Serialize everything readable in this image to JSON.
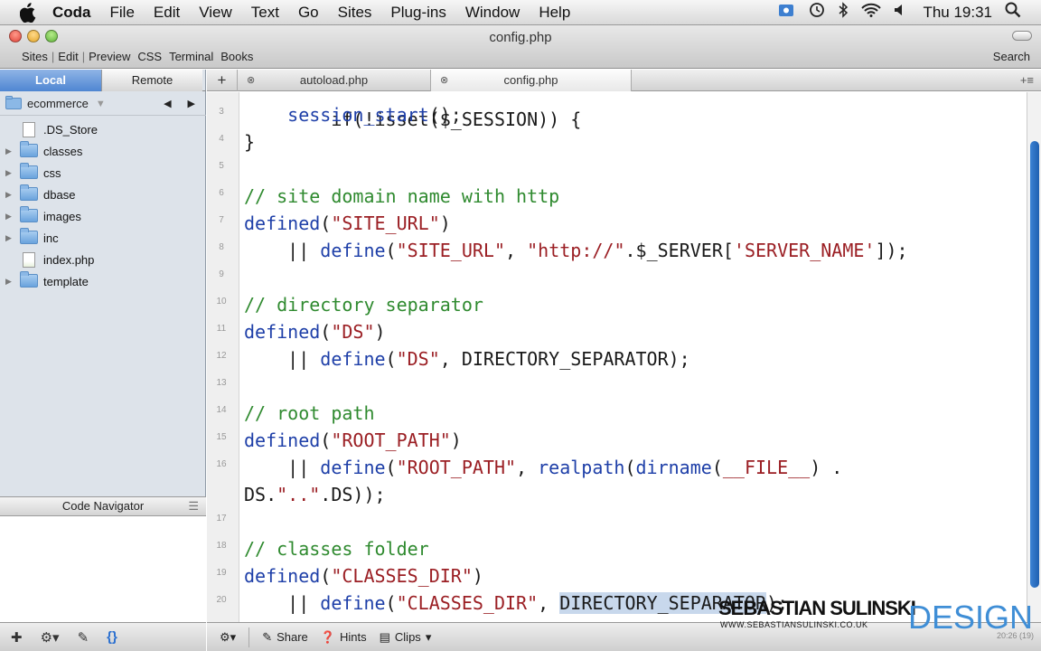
{
  "menubar": {
    "app": "Coda",
    "items": [
      "File",
      "Edit",
      "View",
      "Text",
      "Go",
      "Sites",
      "Plug-ins",
      "Window",
      "Help"
    ],
    "clock": "Thu 19:31"
  },
  "window": {
    "title": "config.php",
    "toolbar_tabs": [
      "Sites",
      "Edit",
      "Preview",
      "CSS",
      "Terminal",
      "Books"
    ],
    "search_label": "Search"
  },
  "sidebar": {
    "local_label": "Local",
    "remote_label": "Remote",
    "site_name": "ecommerce",
    "tree": [
      {
        "label": ".DS_Store",
        "type": "file"
      },
      {
        "label": "classes",
        "type": "folder"
      },
      {
        "label": "css",
        "type": "folder"
      },
      {
        "label": "dbase",
        "type": "folder"
      },
      {
        "label": "images",
        "type": "folder"
      },
      {
        "label": "inc",
        "type": "folder"
      },
      {
        "label": "index.php",
        "type": "php"
      },
      {
        "label": "template",
        "type": "folder"
      }
    ],
    "code_navigator_label": "Code Navigator"
  },
  "tabs": [
    {
      "label": "autoload.php"
    },
    {
      "label": "config.php",
      "active": true
    }
  ],
  "editor": {
    "lines": [
      {
        "n": "3",
        "html": "    session_start();"
      },
      {
        "n": "4",
        "html": "}"
      },
      {
        "n": "5",
        "html": ""
      },
      {
        "n": "6",
        "html": "// site domain name with http"
      },
      {
        "n": "7",
        "html": "defined(\"SITE_URL\")"
      },
      {
        "n": "8",
        "html": "    || define(\"SITE_URL\", \"http://\".$_SERVER['SERVER_NAME']);"
      },
      {
        "n": "9",
        "html": ""
      },
      {
        "n": "10",
        "html": "// directory separator"
      },
      {
        "n": "11",
        "html": "defined(\"DS\")"
      },
      {
        "n": "12",
        "html": "    || define(\"DS\", DIRECTORY_SEPARATOR);"
      },
      {
        "n": "13",
        "html": ""
      },
      {
        "n": "14",
        "html": "// root path"
      },
      {
        "n": "15",
        "html": "defined(\"ROOT_PATH\")"
      },
      {
        "n": "16",
        "html": "    || define(\"ROOT_PATH\", realpath(dirname(__FILE__) ."
      },
      {
        "n": "",
        "html": "DS.\"..\".DS));"
      },
      {
        "n": "17",
        "html": ""
      },
      {
        "n": "18",
        "html": "// classes folder"
      },
      {
        "n": "19",
        "html": "defined(\"CLASSES_DIR\")"
      },
      {
        "n": "20",
        "html": "    || define(\"CLASSES_DIR\", DIRECTORY_SEPARATOR);"
      }
    ],
    "partial_top_line": "if(!isset($_SESSION)) {"
  },
  "bottom_bar": {
    "share": "Share",
    "hints": "Hints",
    "clips": "Clips",
    "position": "20:26 (19)"
  },
  "watermark": {
    "name": "SEBASTIAN SULINSKI",
    "url": "WWW.SEBASTIANSULINSKI.CO.UK",
    "brand": "DESIGN"
  },
  "colors": {
    "comment": "#2f8a2f",
    "keyword": "#1e3fa8",
    "string": "#9b1f24",
    "selection": "#c8d8ec",
    "accent": "#3f8ed6"
  }
}
